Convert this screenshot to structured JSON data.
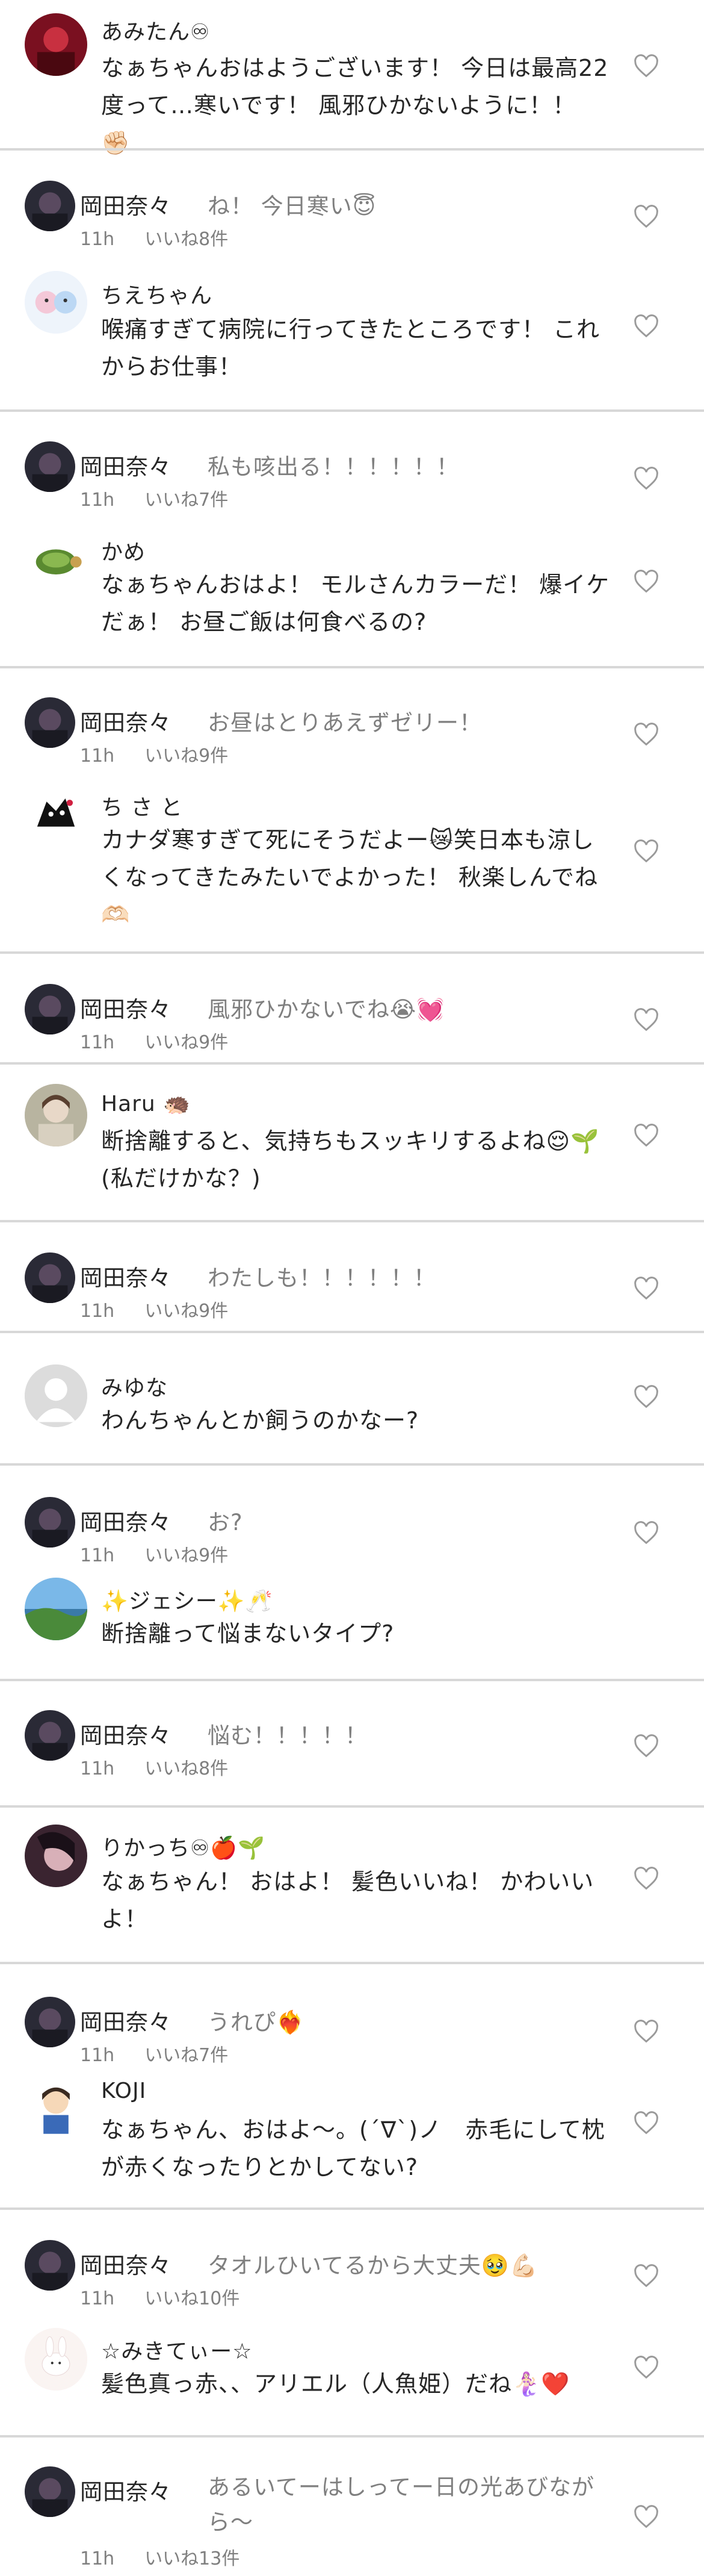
{
  "comments": [
    {
      "user": "あみたん♾",
      "text": "なぁちゃんおはようございます！ 今日は最高22度って…寒いです！ 風邪ひかないように！！ ✊🏻"
    },
    {
      "user": "ちえちゃん",
      "text": "喉痛すぎて病院に行ってきたところです！ これからお仕事！"
    },
    {
      "user": "かめ",
      "text": "なぁちゃんおはよ！ モルさんカラーだ！ 爆イケだぁ！ お昼ご飯は何食べるの?"
    },
    {
      "user": "ち さ と",
      "text": "カナダ寒すぎて死にそうだよー😿笑日本も涼しくなってきたみたいでよかった！ 秋楽しんでね🫶🏻"
    },
    {
      "user": "Haru 🦔",
      "text": "断捨離すると、気持ちもスッキリするよね😌🌱 (私だけかな？)"
    },
    {
      "user": "みゆな",
      "text": "わんちゃんとか飼うのかなー?"
    },
    {
      "user": "✨ジェシー✨🥂",
      "text": "断捨離って悩まないタイプ?"
    },
    {
      "user": "りかっち♾🍎🌱",
      "text": "なぁちゃん！ おはよ！ 髪色いいね！ かわいいよ！"
    },
    {
      "user": "KOJI",
      "text": "なぁちゃん、おはよ～。(´∇`)ノ　赤毛にして枕が赤くなったりとかしてない?"
    },
    {
      "user": "☆みきてぃー☆",
      "text": "髪色真っ赤、、アリエル（人魚姫）だね🧜🏻‍♀️❤️"
    }
  ],
  "replies": [
    {
      "user": "岡田奈々",
      "text": "ね！ 今日寒い😇",
      "time": "11h",
      "likes": "いいね8件"
    },
    {
      "user": "岡田奈々",
      "text": "私も咳出る！！！！！！",
      "time": "11h",
      "likes": "いいね7件"
    },
    {
      "user": "岡田奈々",
      "text": "お昼はとりあえずゼリー！",
      "time": "11h",
      "likes": "いいね9件"
    },
    {
      "user": "岡田奈々",
      "text": "風邪ひかないでね😭💓",
      "time": "11h",
      "likes": "いいね9件"
    },
    {
      "user": "岡田奈々",
      "text": "わたしも！！！！！！",
      "time": "11h",
      "likes": "いいね9件"
    },
    {
      "user": "岡田奈々",
      "text": "お?",
      "time": "11h",
      "likes": "いいね9件"
    },
    {
      "user": "岡田奈々",
      "text": "悩む！！！！！",
      "time": "11h",
      "likes": "いいね8件"
    },
    {
      "user": "岡田奈々",
      "text": "うれぴ❤️‍🔥",
      "time": "11h",
      "likes": "いいね7件"
    },
    {
      "user": "岡田奈々",
      "text": "タオルひいてるから大丈夫🥹💪🏻",
      "time": "11h",
      "likes": "いいね10件"
    },
    {
      "user": "岡田奈々",
      "text": "あるいてーはしってー日の光あびながら～",
      "time": "11h",
      "likes": "いいね13件"
    }
  ]
}
